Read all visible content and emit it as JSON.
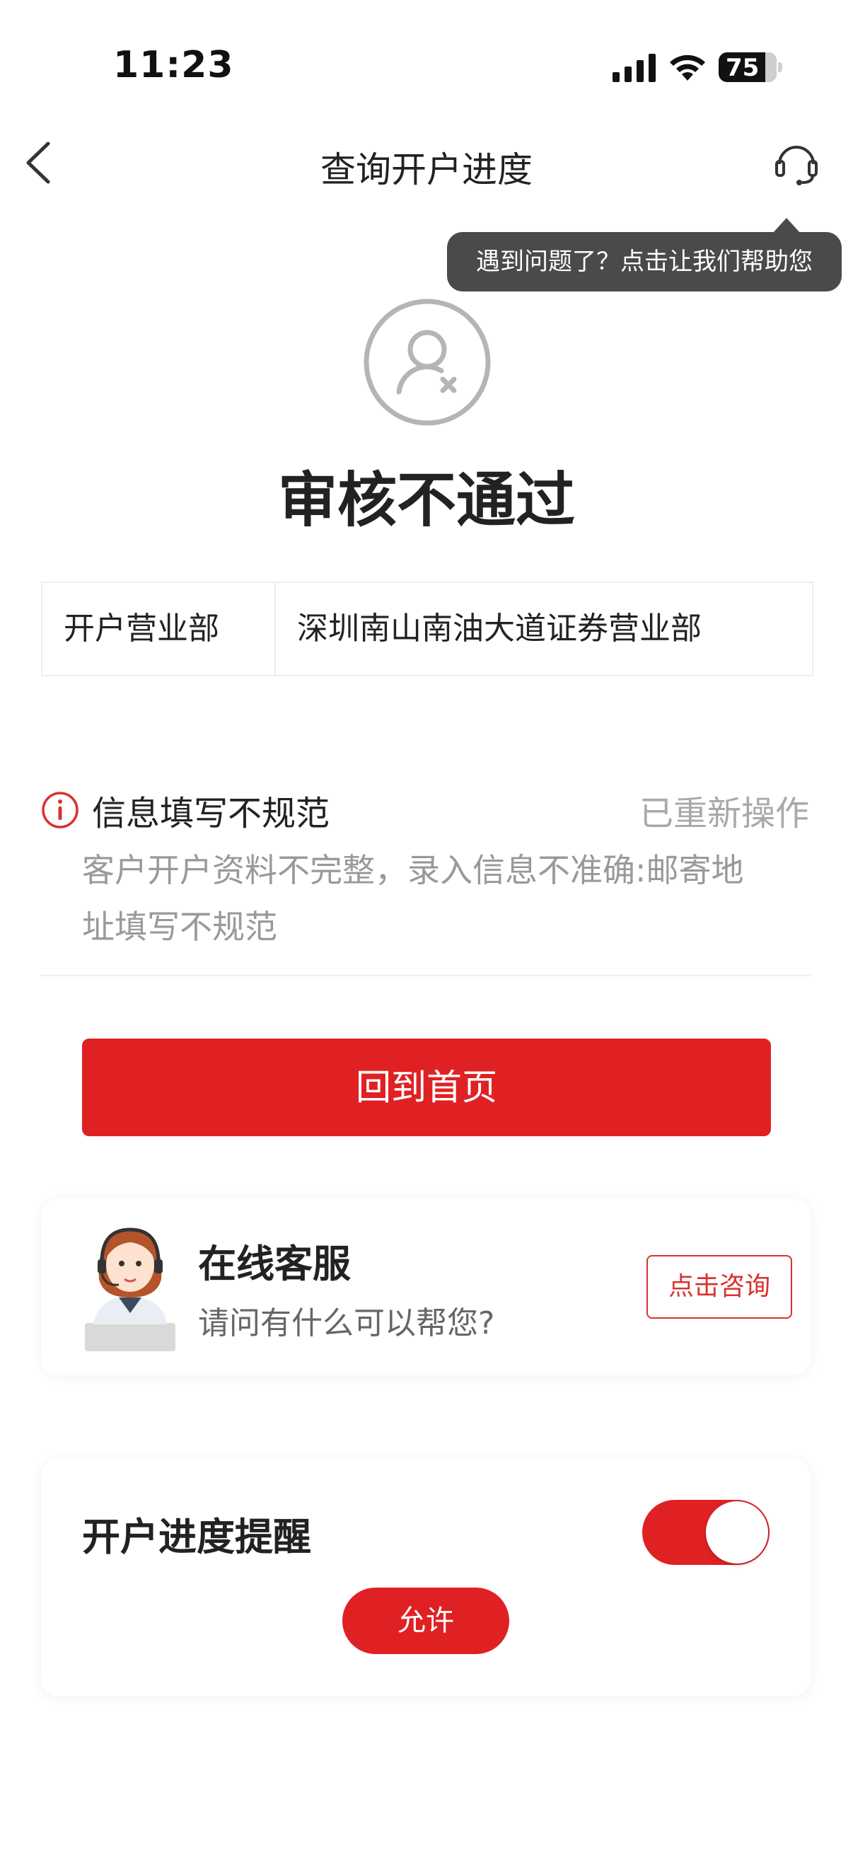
{
  "status_bar": {
    "time": "11:23",
    "battery": "75"
  },
  "nav": {
    "title": "查询开户进度"
  },
  "tooltip": {
    "text": "遇到问题了？点击让我们帮助您"
  },
  "result": {
    "title": "审核不通过",
    "icon": "user-reject-icon"
  },
  "info": {
    "label": "开户营业部",
    "value": "深圳南山南油大道证券营业部"
  },
  "reason": {
    "title": "信息填写不规范",
    "status": "已重新操作",
    "description": "客户开户资料不完整，录入信息不准确:邮寄地址填写不规范"
  },
  "actions": {
    "home_label": "回到首页"
  },
  "service": {
    "title": "在线客服",
    "subtitle": "请问有什么可以帮您?",
    "consult_label": "点击咨询"
  },
  "reminder": {
    "title": "开户进度提醒",
    "toggle_on": true,
    "allow_label": "允许"
  },
  "colors": {
    "accent": "#e02124",
    "tooltip_bg": "#4a4a4a",
    "muted_text": "#999999"
  }
}
